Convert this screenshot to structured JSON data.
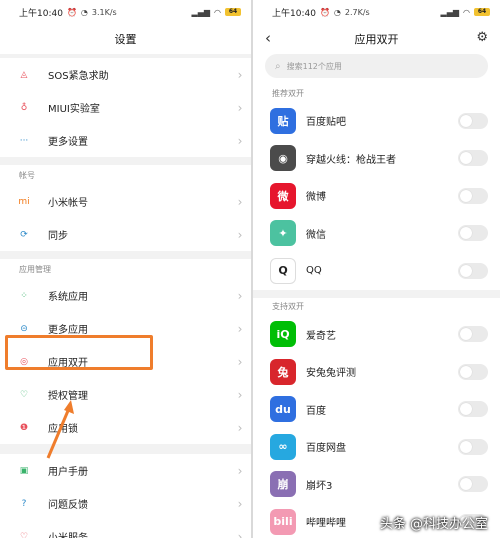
{
  "left": {
    "status": {
      "time": "上午10:40",
      "speed": "3.1K/s",
      "battery": "64"
    },
    "title": "设置",
    "group1": [
      {
        "label": "SOS紧急求助",
        "icon": "sos-icon",
        "glyph": "◬",
        "color": "#e8505b"
      },
      {
        "label": "MIUI实验室",
        "icon": "flask-icon",
        "glyph": "♁",
        "color": "#e8505b"
      },
      {
        "label": "更多设置",
        "icon": "more-dots-icon",
        "glyph": "···",
        "color": "#2a88c8"
      }
    ],
    "section_account": "帐号",
    "group2": [
      {
        "label": "小米帐号",
        "icon": "mi-icon",
        "glyph": "mi",
        "color": "#f27a1a"
      },
      {
        "label": "同步",
        "icon": "sync-icon",
        "glyph": "⟳",
        "color": "#2a88c8"
      }
    ],
    "section_apps": "应用管理",
    "group3": [
      {
        "label": "系统应用",
        "icon": "grid-icon",
        "glyph": "⁘",
        "color": "#39b36b"
      },
      {
        "label": "更多应用",
        "icon": "more-apps-icon",
        "glyph": "⊝",
        "color": "#2a88c8"
      },
      {
        "label": "应用双开",
        "icon": "dual-app-icon",
        "glyph": "◎",
        "color": "#e8505b"
      },
      {
        "label": "授权管理",
        "icon": "shield-icon",
        "glyph": "♡",
        "color": "#39b36b"
      },
      {
        "label": "应用锁",
        "icon": "lock-icon",
        "glyph": "❶",
        "color": "#e8505b"
      }
    ],
    "group4": [
      {
        "label": "用户手册",
        "icon": "book-icon",
        "glyph": "▣",
        "color": "#39b36b"
      },
      {
        "label": "问题反馈",
        "icon": "feedback-icon",
        "glyph": "?",
        "color": "#2a88c8"
      },
      {
        "label": "小米服务",
        "icon": "heart-icon",
        "glyph": "♡",
        "color": "#e8505b"
      }
    ]
  },
  "right": {
    "status": {
      "time": "上午10:40",
      "speed": "2.7K/s",
      "battery": "64"
    },
    "title": "应用双开",
    "search_placeholder": "搜索112个应用",
    "section_recommended": "推荐双开",
    "recommended": [
      {
        "label": "百度贴吧",
        "icon": "tieba-icon",
        "glyph": "贴",
        "color": "#2f6fe0"
      },
      {
        "label": "穿越火线：枪战王者",
        "icon": "crossfire-icon",
        "glyph": "◉",
        "color": "#4b4b4b"
      },
      {
        "label": "微博",
        "icon": "weibo-icon",
        "glyph": "微",
        "color": "#e6162d"
      },
      {
        "label": "微信",
        "icon": "wechat-icon",
        "glyph": "✦",
        "color": "#4cc2a0"
      },
      {
        "label": "QQ",
        "icon": "qq-icon",
        "glyph": "Q",
        "color": "#222222"
      }
    ],
    "section_supported": "支持双开",
    "supported": [
      {
        "label": "爱奇艺",
        "icon": "iqiyi-icon",
        "glyph": "iQ",
        "color": "#00be06"
      },
      {
        "label": "安兔兔评测",
        "icon": "antutu-icon",
        "glyph": "兔",
        "color": "#d8262c"
      },
      {
        "label": "百度",
        "icon": "baidu-icon",
        "glyph": "du",
        "color": "#2f6fe0"
      },
      {
        "label": "百度网盘",
        "icon": "baidu-pan-icon",
        "glyph": "∞",
        "color": "#26a8e0"
      },
      {
        "label": "崩坏3",
        "icon": "honkai-icon",
        "glyph": "崩",
        "color": "#8a6fb3"
      },
      {
        "label": "哔哩哔哩",
        "icon": "bilibili-icon",
        "glyph": "bili",
        "color": "#f39ab3"
      }
    ]
  },
  "watermark": "头条 @科技办公室"
}
